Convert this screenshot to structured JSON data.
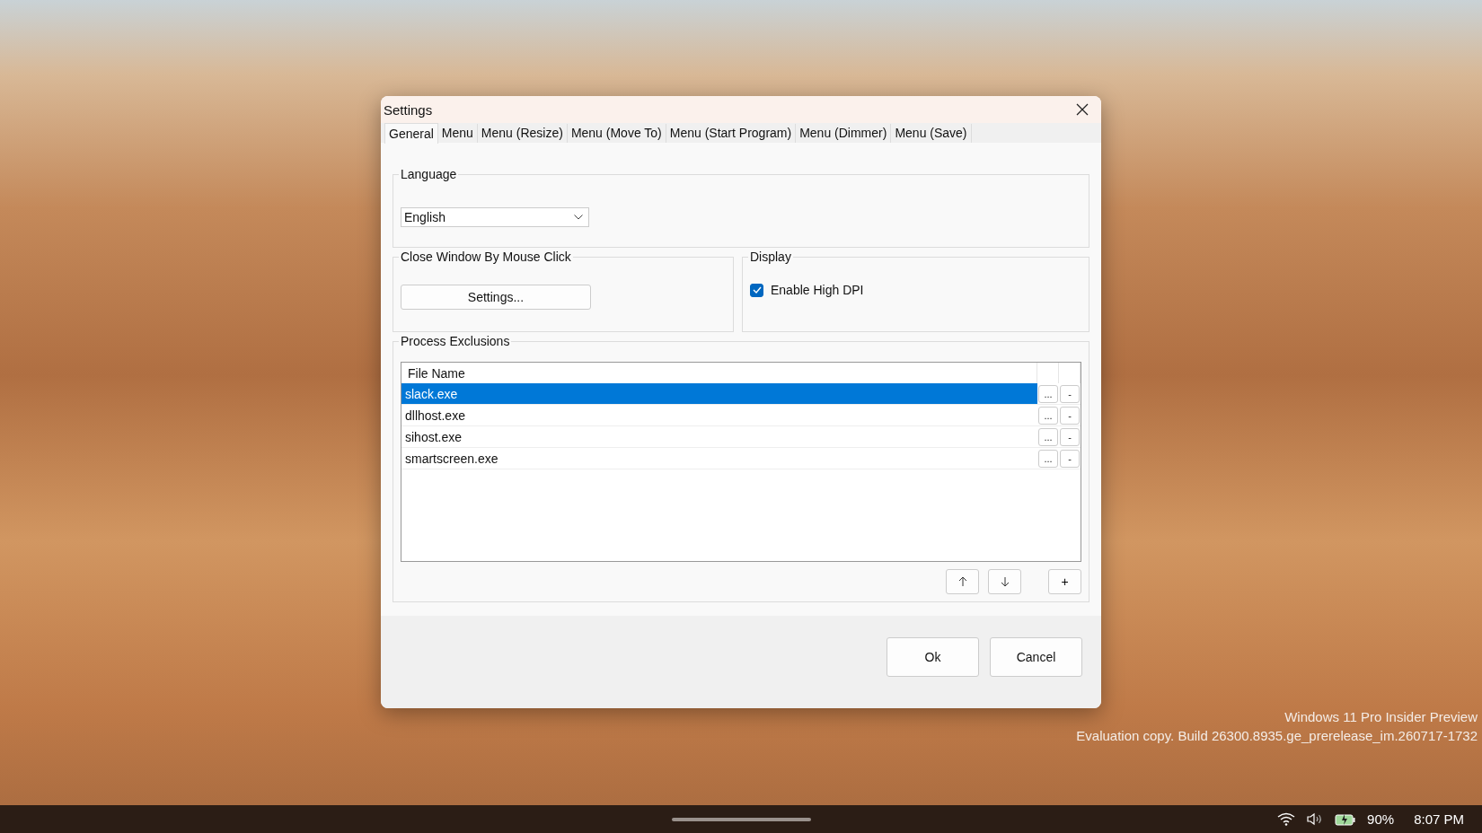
{
  "window": {
    "title": "Settings"
  },
  "tabs": [
    {
      "label": "General",
      "selected": true
    },
    {
      "label": "Menu",
      "selected": false
    },
    {
      "label": "Menu (Resize)",
      "selected": false
    },
    {
      "label": "Menu (Move To)",
      "selected": false
    },
    {
      "label": "Menu (Start Program)",
      "selected": false
    },
    {
      "label": "Menu (Dimmer)",
      "selected": false
    },
    {
      "label": "Menu (Save)",
      "selected": false
    }
  ],
  "language": {
    "label": "Language",
    "value": "English"
  },
  "close_window": {
    "label": "Close Window By Mouse Click",
    "button": "Settings..."
  },
  "display": {
    "label": "Display",
    "checkbox": {
      "label": "Enable High DPI",
      "checked": true
    }
  },
  "process_exclusions": {
    "label": "Process Exclusions",
    "column": "File Name",
    "add": "+",
    "rows": [
      {
        "name": "slack.exe",
        "selected": true,
        "browse": "...",
        "remove": "-"
      },
      {
        "name": "dllhost.exe",
        "selected": false,
        "browse": "...",
        "remove": "-"
      },
      {
        "name": "sihost.exe",
        "selected": false,
        "browse": "...",
        "remove": "-"
      },
      {
        "name": "smartscreen.exe",
        "selected": false,
        "browse": "...",
        "remove": "-"
      }
    ]
  },
  "buttons": [
    "Ok",
    "Cancel"
  ],
  "desktop": {
    "system_notice": [
      "Windows 11 Pro Insider Preview",
      "Evaluation copy. Build 26300.8935.ge_prerelease_im.260717-1732"
    ]
  },
  "taskbar": {
    "battery": "90%",
    "time": "8:07 PM"
  }
}
